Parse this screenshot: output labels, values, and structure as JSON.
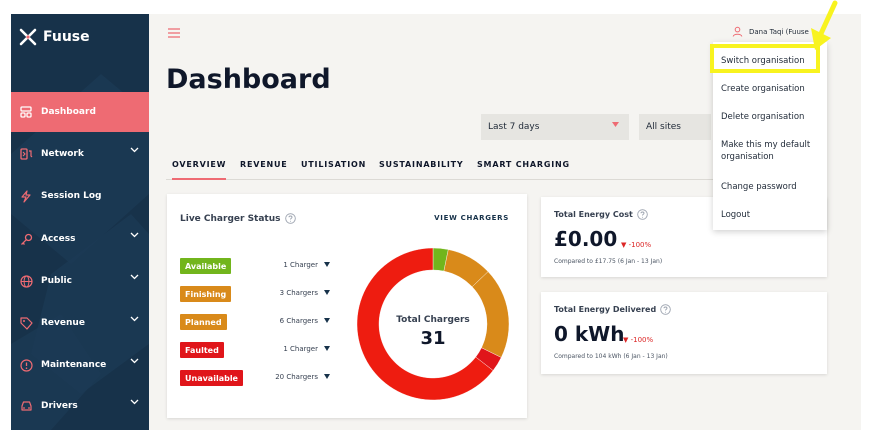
{
  "brand": {
    "name": "Fuuse"
  },
  "sidebar": {
    "items": [
      {
        "label": "Dashboard",
        "icon": "dashboard-icon",
        "active": true,
        "has_chevron": false
      },
      {
        "label": "Network",
        "icon": "network-icon",
        "active": false,
        "has_chevron": true
      },
      {
        "label": "Session Log",
        "icon": "lightning-icon",
        "active": false,
        "has_chevron": false
      },
      {
        "label": "Access",
        "icon": "key-icon",
        "active": false,
        "has_chevron": true
      },
      {
        "label": "Public",
        "icon": "globe-icon",
        "active": false,
        "has_chevron": true
      },
      {
        "label": "Revenue",
        "icon": "tag-icon",
        "active": false,
        "has_chevron": true
      },
      {
        "label": "Maintenance",
        "icon": "alert-circle-icon",
        "active": false,
        "has_chevron": true
      },
      {
        "label": "Drivers",
        "icon": "car-icon",
        "active": false,
        "has_chevron": true
      }
    ]
  },
  "header": {
    "user_name": "Dana Taqi (Fuuse"
  },
  "page": {
    "title": "Dashboard"
  },
  "filters": {
    "period": "Last 7 days",
    "sites": "All sites"
  },
  "tabs": [
    {
      "label": "OVERVIEW",
      "active": true
    },
    {
      "label": "REVENUE",
      "active": false
    },
    {
      "label": "UTILISATION",
      "active": false
    },
    {
      "label": "SUSTAINABILITY",
      "active": false
    },
    {
      "label": "SMART CHARGING",
      "active": false
    }
  ],
  "live_status": {
    "title": "Live Charger Status",
    "view_link": "VIEW CHARGERS",
    "rows": [
      {
        "label": "Available",
        "count": "1 Charger",
        "color": "#72b51c"
      },
      {
        "label": "Finishing",
        "count": "3 Chargers",
        "color": "#d98a1a"
      },
      {
        "label": "Planned",
        "count": "6 Chargers",
        "color": "#d98a1a"
      },
      {
        "label": "Faulted",
        "count": "1 Charger",
        "color": "#e0151a"
      },
      {
        "label": "Unavailable",
        "count": "20 Chargers",
        "color": "#e0151a"
      }
    ],
    "total_label": "Total Chargers",
    "total_value": "31"
  },
  "chart_data": {
    "type": "pie",
    "categories": [
      "Available",
      "Finishing",
      "Planned",
      "Faulted",
      "Unavailable"
    ],
    "values": [
      1,
      3,
      6,
      1,
      20
    ],
    "colors": [
      "#72b51c",
      "#d98a1a",
      "#d98a1a",
      "#e0151a",
      "#ee1c10"
    ],
    "title": "Total Chargers"
  },
  "energy_cost": {
    "title": "Total Energy Cost",
    "value": "£0.00",
    "delta": "-100%",
    "comparison": "Compared to £17.75 (6 Jan - 13 Jan)"
  },
  "energy_delivered": {
    "title": "Total Energy Delivered",
    "value": "0 kWh",
    "delta": "-100%",
    "comparison": "Compared to 104 kWh (6 Jan - 13 Jan)"
  },
  "user_menu": {
    "items": [
      "Switch organisation",
      "Create organisation",
      "Delete organisation",
      "Make this my default organisation",
      "Change password",
      "Logout"
    ]
  },
  "colors": {
    "sidebar_bg": "#17324a",
    "accent": "#ee6b73",
    "annotation": "#f8f31f"
  }
}
